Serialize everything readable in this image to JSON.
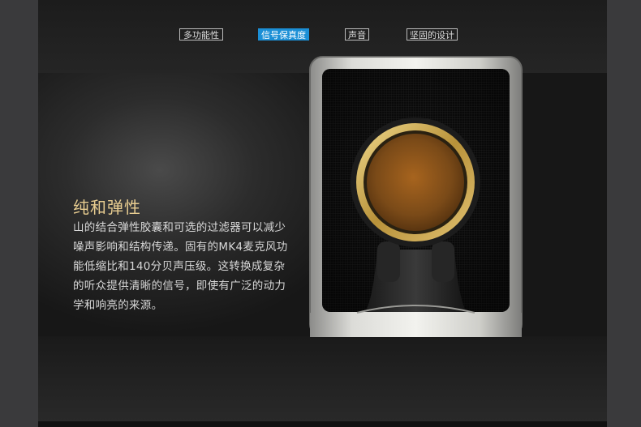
{
  "nav": {
    "tabs": [
      {
        "label": "多功能性",
        "active": false
      },
      {
        "label": "信号保真度",
        "active": true
      },
      {
        "label": "声音",
        "active": false
      },
      {
        "label": "坚固的设计",
        "active": false
      }
    ]
  },
  "feature": {
    "title": "纯和弹性",
    "lines": [
      "山的结合弹性胶囊和可选的过滤器可以减少",
      "噪声影响和结构传递。固有的MK4麦克风功",
      "能低缩比和140分贝声压级。这转换成复杂",
      "的听众提供清晰的信号，即使有广泛的动力",
      "学和响亮的来源。"
    ]
  },
  "colors": {
    "accent": "#1b8fd6",
    "title": "#e7cc90",
    "gold": "#c9a54a"
  }
}
